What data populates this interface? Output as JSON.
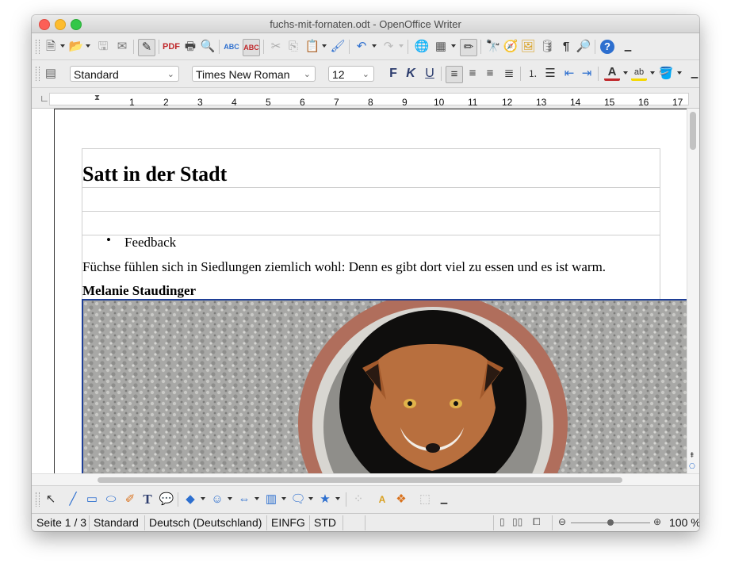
{
  "window": {
    "title": "fuchs-mit-fornaten.odt - OpenOffice Writer"
  },
  "formatting": {
    "paragraph_style": "Standard",
    "font_name": "Times New Roman",
    "font_size": "12",
    "bold_label": "F",
    "italic_label": "K",
    "underline_label": "U"
  },
  "ruler": {
    "marks": [
      "1",
      "2",
      "3",
      "4",
      "5",
      "6",
      "7",
      "8",
      "9",
      "10",
      "11",
      "12",
      "13",
      "14",
      "15",
      "16",
      "17"
    ]
  },
  "document": {
    "heading": "Satt in der Stadt",
    "bullet_item": "Feedback",
    "paragraph": "Füchse fühlen sich in Siedlungen ziemlich wohl: Denn es gibt dort viel zu essen und es ist warm.",
    "author": "Melanie Staudinger"
  },
  "statusbar": {
    "page": "Seite 1 / 3",
    "style": "Standard",
    "language": "Deutsch (Deutschland)",
    "insert_mode": "EINFG",
    "selection_mode": "STD",
    "zoom": "100 %"
  },
  "zoom": {
    "slider_level": 0.5
  },
  "colors": {
    "font_color": "#c0282b",
    "highlight_color": "#f5d800",
    "selection_border": "#1f3f96",
    "help_icon": "#2d6fcf"
  }
}
